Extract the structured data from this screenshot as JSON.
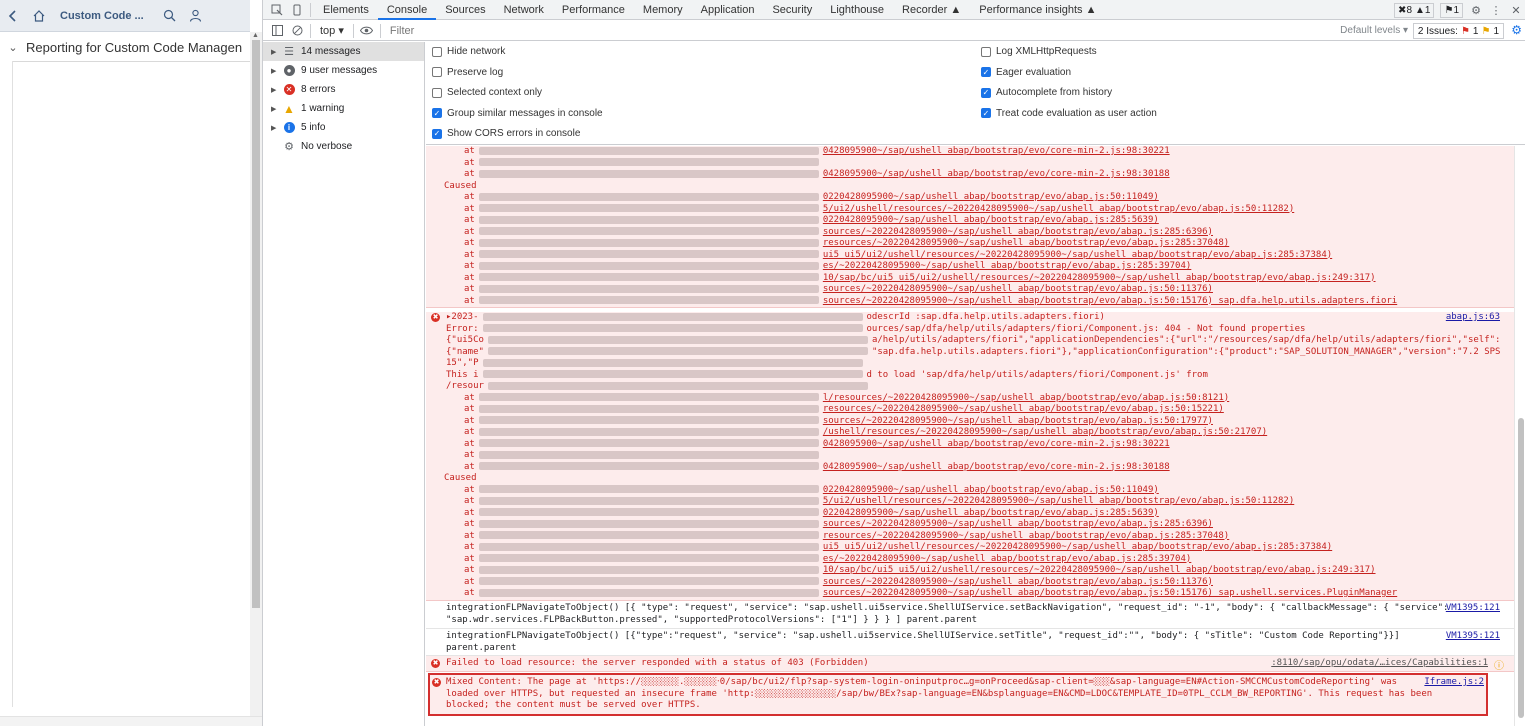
{
  "app": {
    "title": "Custom Code ...",
    "tree_item": "Reporting for Custom Code Managen"
  },
  "devtools": {
    "tabs": [
      "Elements",
      "Console",
      "Sources",
      "Network",
      "Performance",
      "Memory",
      "Application",
      "Security",
      "Lighthouse",
      "Recorder ▲",
      "Performance insights ▲"
    ],
    "active_tab": "Console",
    "badges": {
      "errors": "8",
      "warnings": "1",
      "issues": "1"
    },
    "context": "top ▾",
    "filter_placeholder": "Filter",
    "default_levels": "Default levels ▾",
    "issues_label": "2 Issues:",
    "issues_err": "1",
    "issues_warn": "1"
  },
  "sidebar": [
    {
      "label": "14 messages",
      "icon": "list-icon",
      "selected": true
    },
    {
      "label": "9 user messages",
      "icon": "user-icon"
    },
    {
      "label": "8 errors",
      "icon": "error-icon"
    },
    {
      "label": "1 warning",
      "icon": "warning-icon"
    },
    {
      "label": "5 info",
      "icon": "info-icon"
    },
    {
      "label": "No verbose",
      "icon": "bug-icon"
    }
  ],
  "settings": {
    "left": [
      {
        "label": "Hide network",
        "checked": false
      },
      {
        "label": "Preserve log",
        "checked": false
      },
      {
        "label": "Selected context only",
        "checked": false
      },
      {
        "label": "Group similar messages in console",
        "checked": true
      },
      {
        "label": "Show CORS errors in console",
        "checked": true
      }
    ],
    "right": [
      {
        "label": "Log XMLHttpRequests",
        "checked": false
      },
      {
        "label": "Eager evaluation",
        "checked": true
      },
      {
        "label": "Autocomplete from history",
        "checked": true
      },
      {
        "label": "Treat code evaluation as user action",
        "checked": true
      }
    ]
  },
  "console": {
    "block1": [
      {
        "t": "at",
        "tail": "0428095900~/sap/ushell_abap/bootstrap/evo/core-min-2.js:98:30221"
      },
      {
        "t": "at",
        "tail": ""
      },
      {
        "t": "at",
        "tail": "0428095900~/sap/ushell_abap/bootstrap/evo/core-min-2.js:98:30188"
      },
      {
        "t": "caused",
        "text": "Caused"
      },
      {
        "t": "at",
        "tail": "0220428095900~/sap/ushell_abap/bootstrap/evo/abap.js:50:11049)"
      },
      {
        "t": "at",
        "tail": "5/ui2/ushell/resources/~20220428095900~/sap/ushell_abap/bootstrap/evo/abap.js:50:11282)"
      },
      {
        "t": "at",
        "tail": "0220428095900~/sap/ushell_abap/bootstrap/evo/abap.js:285:5639)"
      },
      {
        "t": "at",
        "tail": "sources/~20220428095900~/sap/ushell_abap/bootstrap/evo/abap.js:285:6396)"
      },
      {
        "t": "at",
        "tail": "resources/~20220428095900~/sap/ushell_abap/bootstrap/evo/abap.js:285:37048)"
      },
      {
        "t": "at",
        "tail": "ui5_ui5/ui2/ushell/resources/~20220428095900~/sap/ushell_abap/bootstrap/evo/abap.js:285:37384)"
      },
      {
        "t": "at",
        "tail": "es/~20220428095900~/sap/ushell_abap/bootstrap/evo/abap.js:285:39704)"
      },
      {
        "t": "at",
        "tail": "10/sap/bc/ui5_ui5/ui2/ushell/resources/~20220428095900~/sap/ushell_abap/bootstrap/evo/abap.js:249:317)"
      },
      {
        "t": "at",
        "tail": "sources/~20220428095900~/sap/ushell_abap/bootstrap/evo/abap.js:50:11376)"
      },
      {
        "t": "at",
        "tail": "sources/~20220428095900~/sap/ushell_abap/bootstrap/evo/abap.js:50:15176) sap.dfa.help.utils.adapters.fiori"
      }
    ],
    "block2_head": "▸2023-",
    "block2_head_tail": "odescrId :sap.dfa.help.utils.adapters.fiori)",
    "block2_src": "abap.js:63",
    "block2": [
      {
        "t": "plain",
        "text": "Error:",
        "tail": "ources/sap/dfa/help/utils/adapters/fiori/Component.js: 404 - Not found properties"
      },
      {
        "t": "plain",
        "text": "{\"ui5Co",
        "tail": "a/help/utils/adapters/fiori\",\"applicationDependencies\":{\"url\":\"/resources/sap/dfa/help/utils/adapters/fiori\",\"self\":"
      },
      {
        "t": "plain",
        "text": "{\"name\"",
        "tail": "\"sap.dfa.help.utils.adapters.fiori\"},\"applicationConfiguration\":{\"product\":\"SAP_SOLUTION_MANAGER\",\"version\":\"7.2 SPS"
      },
      {
        "t": "plain",
        "text": "15\",\"P",
        "tail": ""
      },
      {
        "t": "plain",
        "text": "  This i",
        "tail": "d to load 'sap/dfa/help/utils/adapters/fiori/Component.js' from"
      },
      {
        "t": "plain",
        "text": "/resour",
        "tail": ""
      },
      {
        "t": "at",
        "tail": "l/resources/~20220428095900~/sap/ushell_abap/bootstrap/evo/abap.js:50:8121)"
      },
      {
        "t": "at",
        "tail": "resources/~20220428095900~/sap/ushell_abap/bootstrap/evo/abap.js:50:15221)"
      },
      {
        "t": "at",
        "tail": "sources/~20220428095900~/sap/ushell_abap/bootstrap/evo/abap.js:50:17977)"
      },
      {
        "t": "at",
        "tail": "/ushell/resources/~20220428095900~/sap/ushell_abap/bootstrap/evo/abap.js:50:21707)"
      },
      {
        "t": "at",
        "tail": "0428095900~/sap/ushell_abap/bootstrap/evo/core-min-2.js:98:30221"
      },
      {
        "t": "at",
        "tail": ""
      },
      {
        "t": "at",
        "tail": "0428095900~/sap/ushell_abap/bootstrap/evo/core-min-2.js:98:30188"
      },
      {
        "t": "caused",
        "text": "Caused"
      },
      {
        "t": "at",
        "tail": "0220428095900~/sap/ushell_abap/bootstrap/evo/abap.js:50:11049)"
      },
      {
        "t": "at",
        "tail": "5/ui2/ushell/resources/~20220428095900~/sap/ushell_abap/bootstrap/evo/abap.js:50:11282)"
      },
      {
        "t": "at",
        "tail": "0220428095900~/sap/ushell_abap/bootstrap/evo/abap.js:285:5639)"
      },
      {
        "t": "at",
        "tail": "sources/~20220428095900~/sap/ushell_abap/bootstrap/evo/abap.js:285:6396)"
      },
      {
        "t": "at",
        "tail": "resources/~20220428095900~/sap/ushell_abap/bootstrap/evo/abap.js:285:37048)"
      },
      {
        "t": "at",
        "tail": "ui5_ui5/ui2/ushell/resources/~20220428095900~/sap/ushell_abap/bootstrap/evo/abap.js:285:37384)"
      },
      {
        "t": "at",
        "tail": "es/~20220428095900~/sap/ushell_abap/bootstrap/evo/abap.js:285:39704)"
      },
      {
        "t": "at",
        "tail": "10/sap/bc/ui5_ui5/ui2/ushell/resources/~20220428095900~/sap/ushell_abap/bootstrap/evo/abap.js:249:317)"
      },
      {
        "t": "at",
        "tail": "sources/~20220428095900~/sap/ushell_abap/bootstrap/evo/abap.js:50:11376)"
      },
      {
        "t": "at",
        "tail": "sources/~20220428095900~/sap/ushell_abap/bootstrap/evo/abap.js:50:15176) sap.ushell.services.PluginManager"
      }
    ],
    "info1": [
      "integrationFLPNavigateToObject() [{ \"type\": \"request\", \"service\": \"sap.ushell.ui5service.ShellUIService.setBackNavigation\", \"request_id\": \"-1\", \"body\": { \"callbackMessage\": { \"service\":",
      "\"sap.wdr.services.FLPBackButton.pressed\", \"supportedProtocolVersions\": [\"1\"] } } } ] parent.parent"
    ],
    "info1_src": "VM1395:121",
    "info2": [
      "integrationFLPNavigateToObject() [{\"type\":\"request\", \"service\": \"sap.ushell.ui5service.ShellUIService.setTitle\", \"request_id\":\"\", \"body\": { \"sTitle\": \"Custom Code Reporting\"}}]",
      "parent.parent"
    ],
    "info2_src": "VM1395:121",
    "failed": "Failed to load resource: the server responded with a status of 403 (Forbidden)",
    "failed_src": ":8110/sap/opu/odata/…ices/Capabilities:1",
    "mixed": [
      "Mixed Content: The page at 'https://░░░░░░░.░░░░░░‧0/sap/bc/ui2/flp?sap-system-login-oninputproc…g=onProceed&sap-client=░░░&sap-language=EN#Action-SMCCMCustomCodeReporting' was",
      "loaded over HTTPS, but requested an insecure frame 'http:░░░░░░░░░░░░░░░/sap/bw/BEx?sap-language=EN&bsplanguage=EN&CMD=LDOC&TEMPLATE_ID=0TPL_CCLM_BW_REPORTING'. This request has been",
      "blocked; the content must be served over HTTPS."
    ],
    "mixed_src": "Iframe.js:2"
  }
}
